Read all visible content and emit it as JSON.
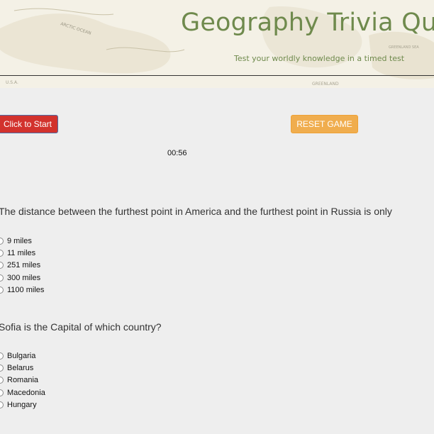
{
  "header": {
    "title": "Geography Trivia Quiz",
    "subtitle": "Test your worldly knowledge in a timed test",
    "map_labels": [
      "ARCTIC OCEAN",
      "GREENLAND",
      "U.S.A.",
      "GREENLAND SEA"
    ]
  },
  "controls": {
    "start_label": "Click to Start",
    "reset_label": "RESET GAME",
    "timer": "00:56"
  },
  "questions": [
    {
      "text": "The distance between the furthest point in America and the furthest point in Russia is only",
      "options": [
        "9 miles",
        "11 miles",
        "251 miles",
        "300 miles",
        "1100 miles"
      ]
    },
    {
      "text": "Sofia is the Capital of which country?",
      "options": [
        "Bulgaria",
        "Belarus",
        "Romania",
        "Macedonia",
        "Hungary"
      ]
    }
  ],
  "colors": {
    "title": "#6f8a4d",
    "start_button": "#d2322d",
    "reset_button": "#f0ad4e",
    "background": "#eeeeee"
  }
}
